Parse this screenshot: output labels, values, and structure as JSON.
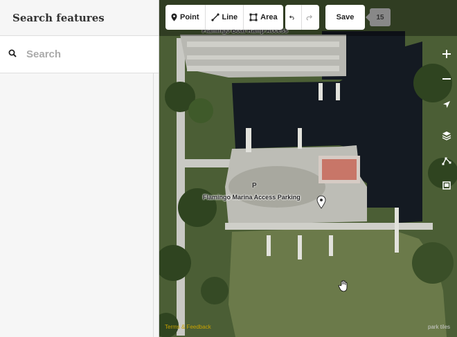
{
  "sidebar": {
    "title": "Search features",
    "search_placeholder": "Search"
  },
  "toolbar": {
    "point_label": "Point",
    "line_label": "Line",
    "area_label": "Area",
    "save_label": "Save",
    "edit_count": "15"
  },
  "map": {
    "label_boat_ramp": "Flamingo Boat Ramp Access",
    "label_marina_parking": "Flamingo Marina Access Parking",
    "parking_symbol": "P",
    "attribution": "Terms & Feedback",
    "imagery_credit": "park tiles"
  },
  "colors": {
    "water_dark": "#141a22",
    "water_green": "#6b7a4a",
    "pavement": "#c9c9c4",
    "tree": "#3f5a2a"
  },
  "icons": {
    "search": "search-icon",
    "point": "map-pin-icon",
    "line": "line-icon",
    "area": "area-icon",
    "undo": "undo-icon",
    "redo": "redo-icon",
    "zoom_in": "plus-icon",
    "zoom_out": "minus-icon",
    "locate": "location-arrow-icon",
    "layers": "layers-icon",
    "map_data": "map-data-icon",
    "issues": "issues-icon"
  }
}
